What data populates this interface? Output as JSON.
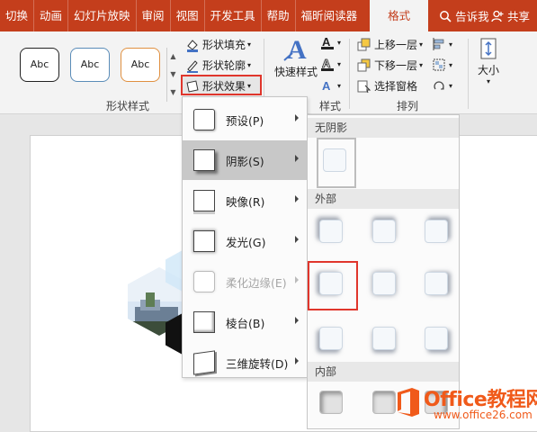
{
  "tabs": [
    {
      "label": "切换"
    },
    {
      "label": "动画"
    },
    {
      "label": "幻灯片放映"
    },
    {
      "label": "审阅"
    },
    {
      "label": "视图"
    },
    {
      "label": "开发工具"
    },
    {
      "label": "帮助"
    },
    {
      "label": "福昕阅读器"
    }
  ],
  "active_tab": "格式",
  "tell_me": "告诉我",
  "share": "共享",
  "ribbon": {
    "style_samples": [
      "Abc",
      "Abc",
      "Abc"
    ],
    "shape_fill": "形状填充",
    "shape_outline": "形状轮廓",
    "shape_effects": "形状效果",
    "shape_styles_group": "形状样式",
    "quick_styles": "快速样式",
    "art_group_partial": "样式",
    "bring_forward": "上移一层",
    "send_backward": "下移一层",
    "selection_pane": "选择窗格",
    "arrange_group": "排列",
    "size": "大小"
  },
  "effects_menu": [
    {
      "label": "预设(P)",
      "disabled": false,
      "selected": false
    },
    {
      "label": "阴影(S)",
      "disabled": false,
      "selected": true
    },
    {
      "label": "映像(R)",
      "disabled": false,
      "selected": false
    },
    {
      "label": "发光(G)",
      "disabled": false,
      "selected": false
    },
    {
      "label": "柔化边缘(E)",
      "disabled": true,
      "selected": false
    },
    {
      "label": "棱台(B)",
      "disabled": false,
      "selected": false
    },
    {
      "label": "三维旋转(D)",
      "disabled": false,
      "selected": false
    }
  ],
  "shadow_submenu": {
    "no_shadow": "无阴影",
    "outer": "外部",
    "inner": "内部"
  },
  "watermark": {
    "brand": "Office教程网",
    "url": "www.office26.com"
  },
  "colors": {
    "tab_bar": "#c43e1c",
    "highlight": "#e0362c",
    "watermark": "#f05a1a"
  }
}
